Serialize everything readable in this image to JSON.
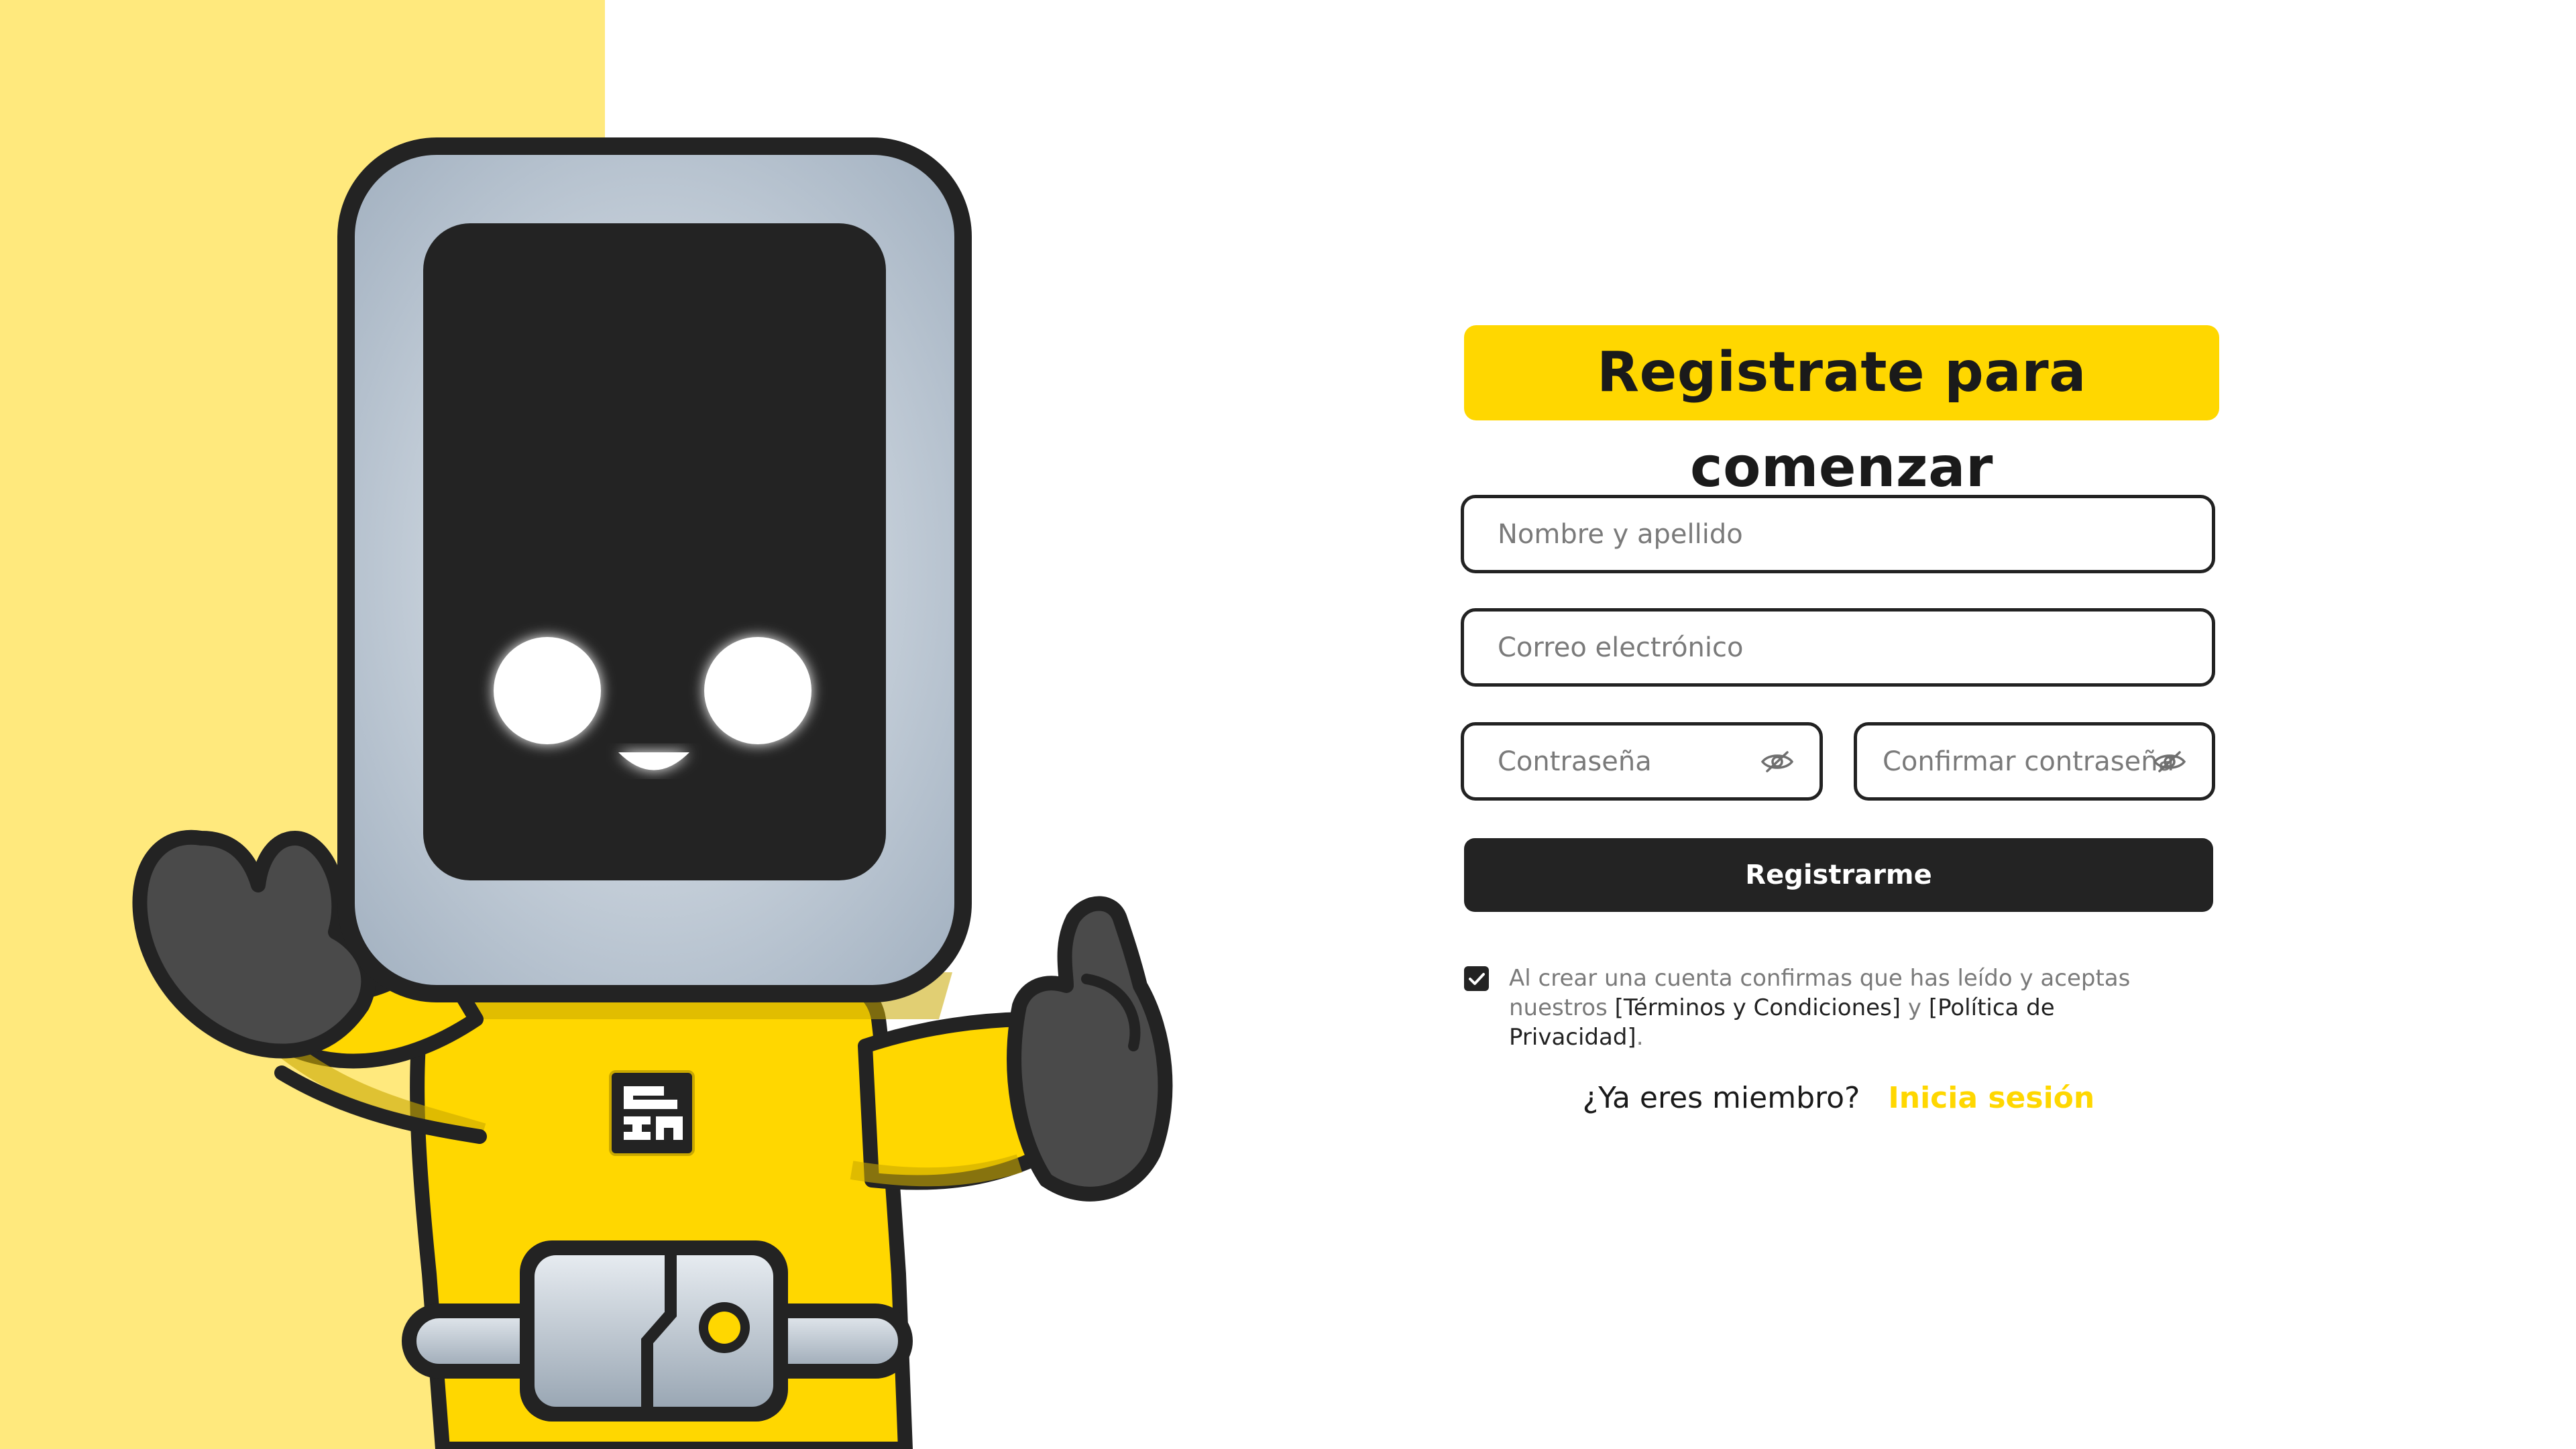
{
  "colors": {
    "accent": "#FFD700",
    "side_panel": "#FFE97D",
    "dark": "#232323",
    "text_muted": "#7a7a7a"
  },
  "form": {
    "title": "Registrate para comenzar",
    "name_placeholder": "Nombre y apellido",
    "email_placeholder": "Correo electrónico",
    "password_placeholder": "Contraseña",
    "confirm_password_placeholder": "Confirmar contraseña",
    "password_toggle_icon": "eye-slash-icon",
    "submit_label": "Registrarme",
    "terms": {
      "checked": true,
      "prefix": "Al crear una cuenta confirmas que has leído y aceptas nuestros ",
      "terms_link": "[Términos y Condiciones]",
      "connector": " y ",
      "privacy_link": "[Política de Privacidad]",
      "suffix": "."
    },
    "login": {
      "prompt": "¿Ya eres miembro?",
      "link": "Inicia sesión"
    }
  },
  "mascot": {
    "logo_icon": "brand-logo-icon"
  }
}
